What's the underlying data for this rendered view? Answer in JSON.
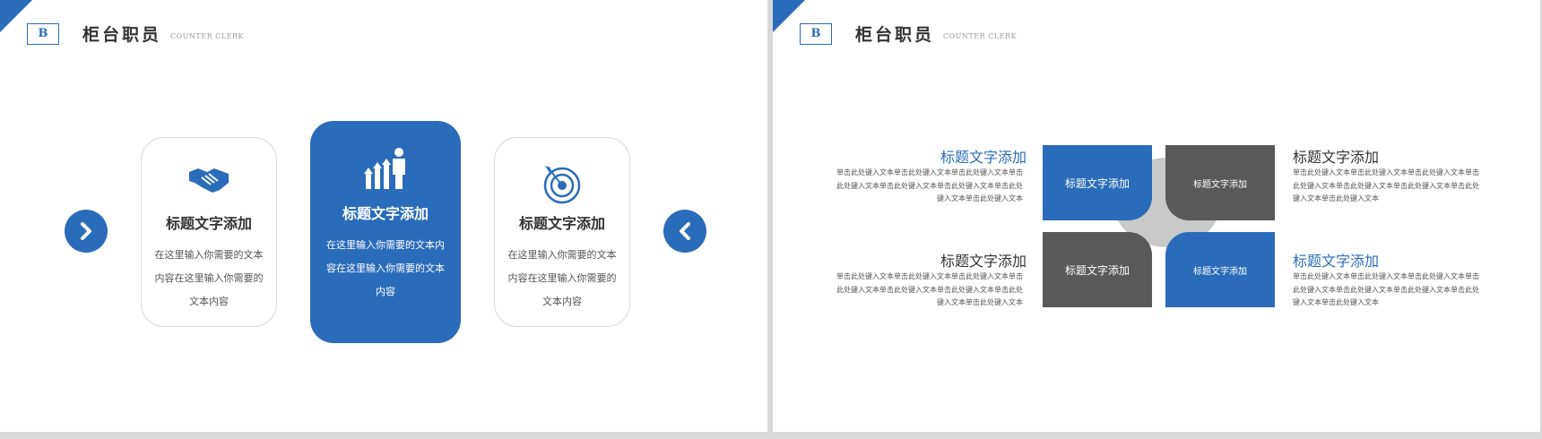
{
  "colors": {
    "accent": "#2a6cba",
    "dark": "#595959",
    "hub": "#c9c9c9",
    "page_bg": "#d9d9d9"
  },
  "header": {
    "badge": "B",
    "title": "柜台职员",
    "subtitle": "COUNTER CLERK"
  },
  "left_slide": {
    "cards": [
      {
        "icon": "handshake-icon",
        "title": "标题文字添加",
        "body": "在这里输入你需要的文本内容在这里输入你需要的文本内容"
      },
      {
        "icon": "growth-person-icon",
        "title": "标题文字添加",
        "body": "在这里输入你需要的文本内容在这里输入你需要的文本内容"
      },
      {
        "icon": "target-icon",
        "title": "标题文字添加",
        "body": "在这里输入你需要的文本内容在这里输入你需要的文本内容"
      }
    ],
    "nav": {
      "next_icon": "chevron-right-icon",
      "prev_icon": "chevron-left-icon"
    }
  },
  "right_slide": {
    "quadrants": [
      "标题文字添加",
      "标题文字添加",
      "标题文字添加",
      "标题文字添加"
    ],
    "blocks": [
      {
        "title": "标题文字添加",
        "body": "单击此处键入文本单击此处键入文本单击此处键入文本单击此处键入文本单击此处键入文本单击此处键入文本单击此处键入文本单击此处键入文本"
      },
      {
        "title": "标题文字添加",
        "body": "单击此处键入文本单击此处键入文本单击此处键入文本单击此处键入文本单击此处键入文本单击此处键入文本单击此处键入文本单击此处键入文本"
      },
      {
        "title": "标题文字添加",
        "body": "单击此处键入文本单击此处键入文本单击此处键入文本单击此处键入文本单击此处键入文本单击此处键入文本单击此处键入文本单击此处键入文本"
      },
      {
        "title": "标题文字添加",
        "body": "单击此处键入文本单击此处键入文本单击此处键入文本单击此处键入文本单击此处键入文本单击此处键入文本单击此处键入文本单击此处键入文本"
      }
    ]
  }
}
